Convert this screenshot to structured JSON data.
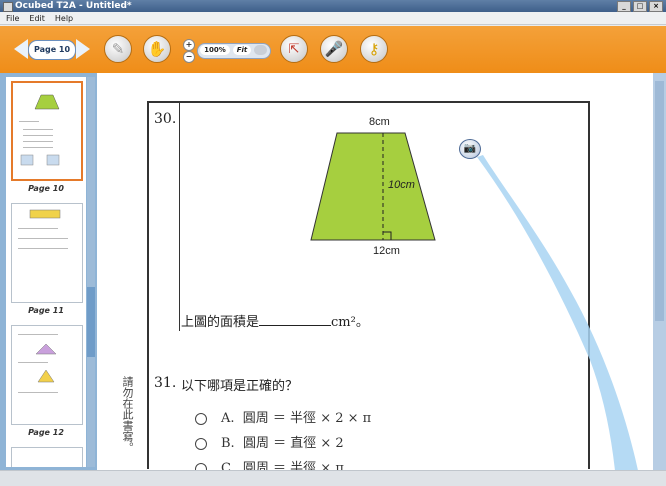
{
  "window": {
    "title": "Ocubed T2A - Untitled*",
    "buttons": [
      "_",
      "□",
      "×"
    ]
  },
  "menu": [
    "File",
    "Edit",
    "Help"
  ],
  "toolbar": {
    "page_label": "Page 10",
    "zoom_value": "100%",
    "zoom_fit": "Fit",
    "zoom_plus": "+",
    "zoom_minus": "−",
    "icons": [
      "pen-icon",
      "hand-icon",
      "export-icon",
      "microphone-icon",
      "key-icon"
    ]
  },
  "thumbnails": [
    {
      "label": "Page 10",
      "selected": true
    },
    {
      "label": "Page 11",
      "selected": false
    },
    {
      "label": "Page 12",
      "selected": false
    }
  ],
  "document": {
    "q30_number": "30.",
    "figure": {
      "top_label": "8cm",
      "height_label": "10cm",
      "bottom_label": "12cm",
      "fill_color": "#a6cf3f"
    },
    "q30_text_before": "上圖的面積是",
    "q30_unit": "cm²。",
    "q31_number": "31.",
    "q31_text": "以下哪項是正確的？",
    "options": [
      {
        "letter": "A.",
        "text": "圓周 ＝ 半徑 × 2 × π"
      },
      {
        "letter": "B.",
        "text": "圓周 ＝ 直徑 × 2"
      },
      {
        "letter": "C.",
        "text": "圓周 ＝ 半徑 × π"
      }
    ],
    "side_note": "請勿在此書寫。"
  },
  "colors": {
    "toolbar": "#ef8d18",
    "beam": "#a8d4f2",
    "selected_border": "#e57a2a"
  }
}
